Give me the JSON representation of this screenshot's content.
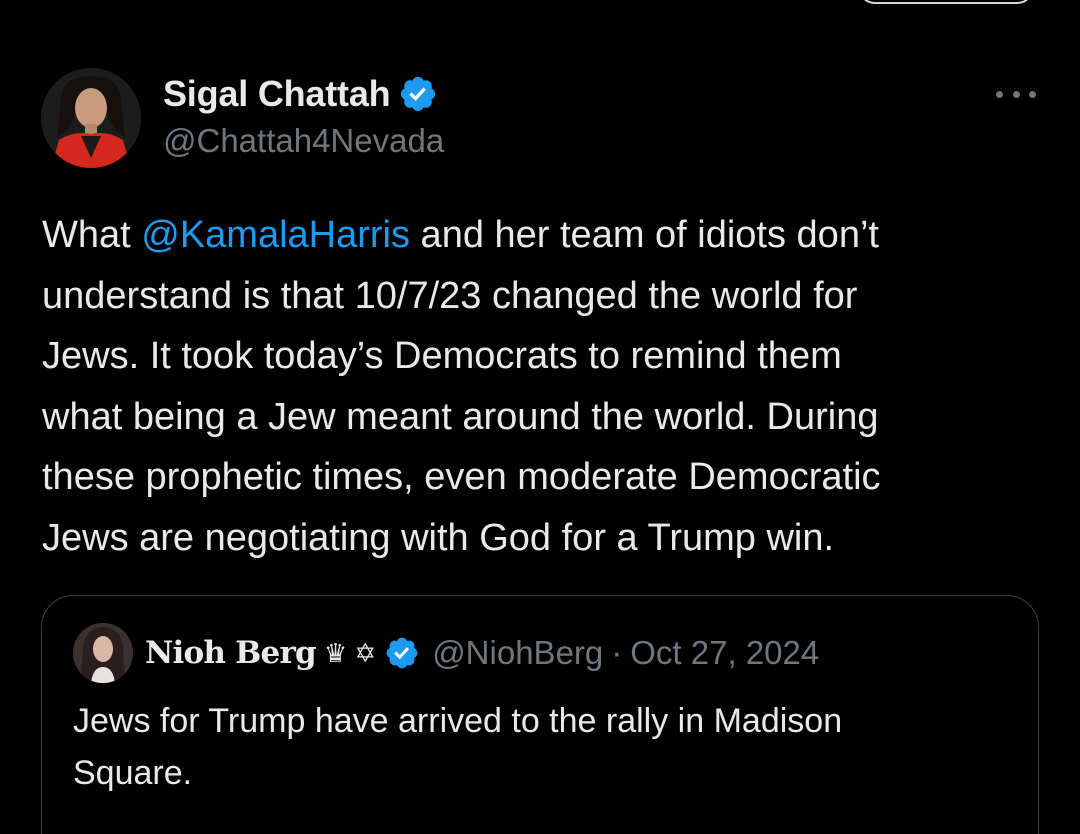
{
  "tweet": {
    "author": {
      "name": "Sigal Chattah",
      "handle": "@Chattah4Nevada",
      "verified": true
    },
    "text": {
      "line1_before": "What ",
      "mention": "@KamalaHarris",
      "line1_after": " and her team of idiots don’t",
      "line2": "understand is that 10/7/23 changed the world for",
      "line3": "Jews. It took today’s Democrats to remind them",
      "line4": "what being a Jew meant around the world. During",
      "line5": "these prophetic times, even moderate Democratic",
      "line6": "Jews are negotiating with God for a Trump win."
    },
    "quoted": {
      "name": "Nioh Berg",
      "emoji": "♛ ✡",
      "verified": true,
      "handle": "@NiohBerg",
      "separator": "·",
      "date": "Oct 27, 2024",
      "text_line1": "Jews for Trump have arrived to the rally in Madison",
      "text_line2": "Square."
    }
  },
  "icons": {
    "verified": "verified-badge-icon",
    "more": "more-horizontal-icon"
  },
  "colors": {
    "background": "#000000",
    "text": "#e7e9ea",
    "secondary": "#71767b",
    "accent": "#1d9bf0",
    "border": "#3b3f43"
  }
}
